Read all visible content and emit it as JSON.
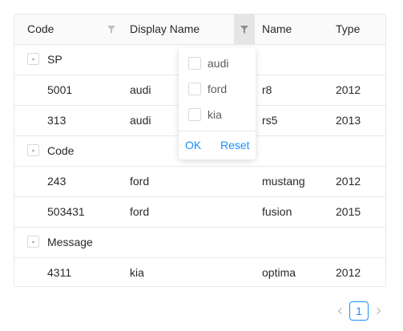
{
  "table": {
    "columns": [
      {
        "label": "Code"
      },
      {
        "label": "Display Name"
      },
      {
        "label": "Name"
      },
      {
        "label": "Type"
      }
    ],
    "groups": [
      {
        "toggle": "-",
        "label": "SP",
        "rows": [
          {
            "code": "5001",
            "display_name": "audi",
            "name": "r8",
            "type": "2012"
          },
          {
            "code": "313",
            "display_name": "audi",
            "name": "rs5",
            "type": "2013"
          }
        ]
      },
      {
        "toggle": "-",
        "label": "Code",
        "rows": [
          {
            "code": "243",
            "display_name": "ford",
            "name": "mustang",
            "type": "2012"
          },
          {
            "code": "503431",
            "display_name": "ford",
            "name": "fusion",
            "type": "2015"
          }
        ]
      },
      {
        "toggle": "-",
        "label": "Message",
        "rows": [
          {
            "code": "4311",
            "display_name": "kia",
            "name": "optima",
            "type": "2012"
          }
        ]
      }
    ]
  },
  "filter_dropdown": {
    "options": [
      {
        "label": "audi",
        "checked": false
      },
      {
        "label": "ford",
        "checked": false
      },
      {
        "label": "kia",
        "checked": false
      }
    ],
    "ok_label": "OK",
    "reset_label": "Reset"
  },
  "pagination": {
    "current_page": "1",
    "prev_icon": "chevron-left-icon",
    "next_icon": "chevron-right-icon"
  },
  "colors": {
    "accent": "#1890ff",
    "border": "#e8e8e8",
    "header_bg": "#fafafa",
    "active_filter_bg": "#e5e5e5",
    "icon_gray": "#bfbfbf",
    "icon_dark": "#8c8c8c"
  }
}
